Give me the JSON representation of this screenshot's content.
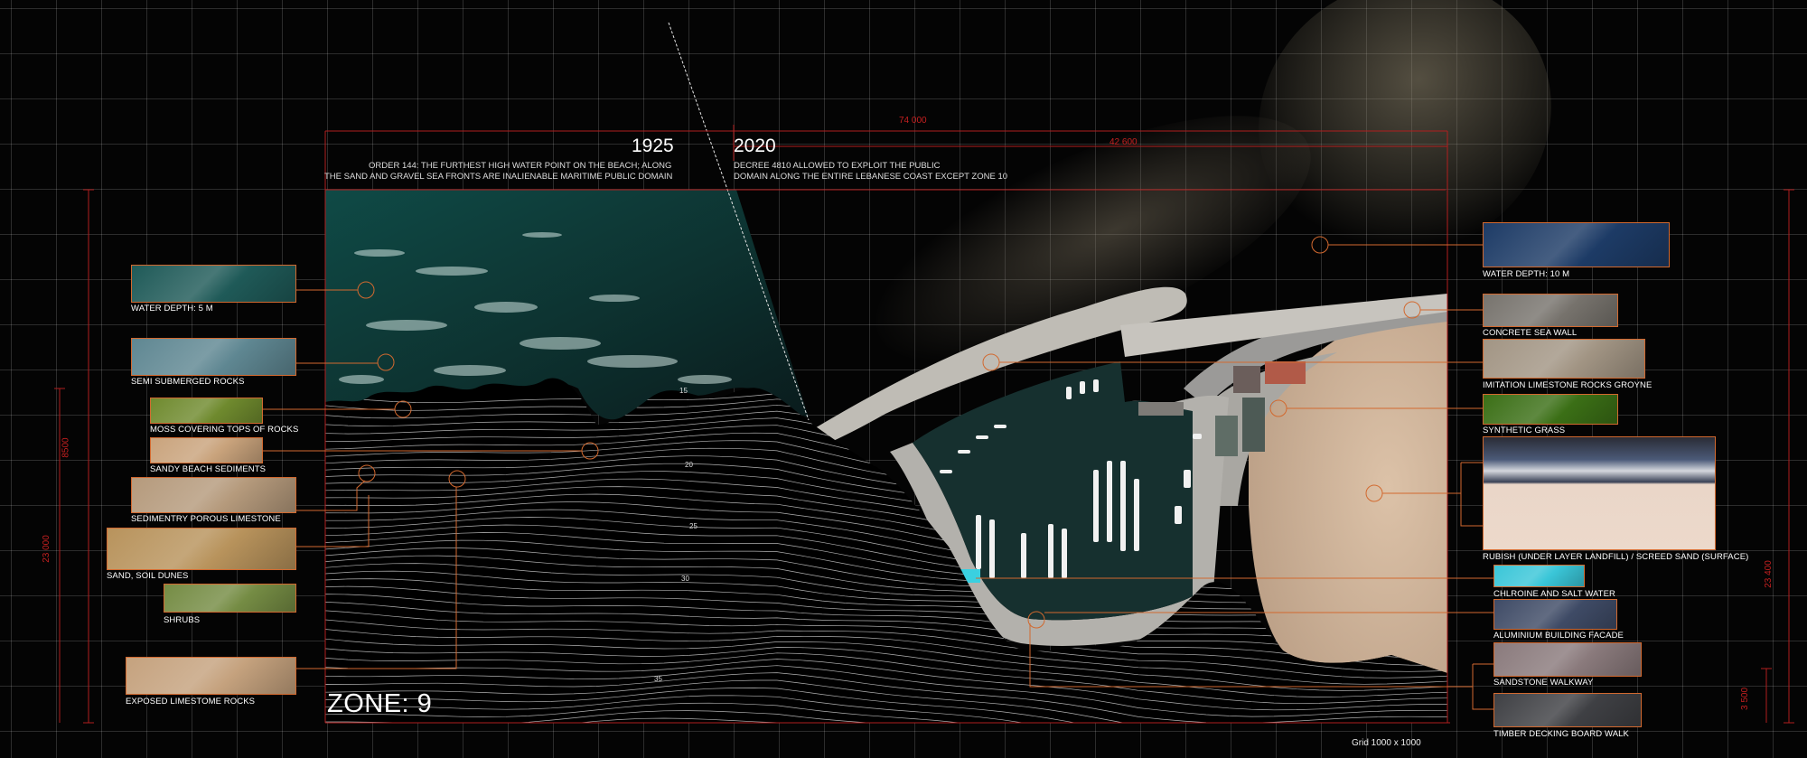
{
  "years": {
    "left": "1925",
    "right": "2020"
  },
  "notes": {
    "left_line1": "ORDER 144: THE FURTHEST HIGH WATER POINT ON THE BEACH; ALONG",
    "left_line2": "THE SAND AND GRAVEL SEA FRONTS ARE INALIENABLE MARITIME PUBLIC DOMAIN",
    "right_line1": "DECREE 4810 ALLOWED TO EXPLOIT THE PUBLIC",
    "right_line2": "DOMAIN ALONG THE ENTIRE LEBANESE COAST EXCEPT ZONE 10"
  },
  "dimensions": {
    "top_total": "74 000",
    "top_right": "42 600",
    "left_outer": "23 000",
    "left_inner": "8500",
    "right_outer": "23 400",
    "right_inner": "3 500"
  },
  "contour_labels": [
    "15",
    "20",
    "25",
    "30",
    "35"
  ],
  "materials_left": [
    {
      "label": "WATER DEPTH: 5 M",
      "color": "#1f5a58"
    },
    {
      "label": "SEMI SUBMERGED ROCKS",
      "color": "#5f8792"
    },
    {
      "label": "MOSS COVERING TOPS OF ROCKS",
      "color": "#6f8a2e"
    },
    {
      "label": "SANDY BEACH SEDIMENTS",
      "color": "#c9a37c"
    },
    {
      "label": "SEDIMENTRY POROUS LIMESTONE",
      "color": "#b59a7c"
    },
    {
      "label": "SAND, SOIL DUNES",
      "color": "#b8935c"
    },
    {
      "label": "SHRUBS",
      "color": "#758c44"
    },
    {
      "label": "EXPOSED LIMESTOME ROCKS",
      "color": "#c5a27e"
    }
  ],
  "materials_right": [
    {
      "label": "WATER DEPTH: 10 M",
      "color": "#1d3b66"
    },
    {
      "label": "CONCRETE SEA WALL",
      "color": "#77736d"
    },
    {
      "label": "IMITATION LIMESTONE ROCKS  GROYNE",
      "color": "#a29584"
    },
    {
      "label": "SYNTHETIC GRASS",
      "color": "#3b6f16"
    },
    {
      "label": "RUBISH (UNDER LAYER LANDFILL) / SCREED SAND (SURFACE)",
      "color": "#ead6c8"
    },
    {
      "label": "CHLROINE AND SALT WATER",
      "color": "#3ac6d8"
    },
    {
      "label": "ALUMINIUM BUILDING FACADE",
      "color": "#3f4b66"
    },
    {
      "label": "SANDSTONE WALKWAY",
      "color": "#8a7a7c"
    },
    {
      "label": "TIMBER DECKING BOARD WALK",
      "color": "#3f4044"
    }
  ],
  "zone_label": "ZONE: 9",
  "grid_label": "Grid 1000 x 1000",
  "colors": {
    "accent": "#d2692f",
    "dimension": "#c52020",
    "sea": "#123f3d",
    "land": "#c9ad93"
  }
}
